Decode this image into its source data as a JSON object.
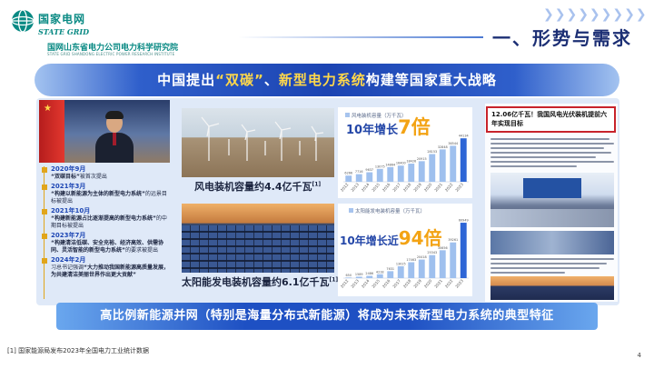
{
  "header": {
    "logo_cn": "国家电网",
    "logo_en": "STATE GRID",
    "org_cn": "国网山东省电力公司电力科学研究院",
    "org_en": "STATE GRID SHANDONG ELECTRIC POWER RESEARCH INSTITUTE",
    "section_title": "一、形势与需求"
  },
  "banner": {
    "part1": "中国提出",
    "hl1": "“双碳”",
    "part2": "、",
    "hl2": "新型电力系统",
    "part3": "构建等国家重大战略"
  },
  "timeline": [
    {
      "date": "2020年9月",
      "pre": "",
      "bold": "“双碳目标”",
      "post": "被首次提出"
    },
    {
      "date": "2021年3月",
      "pre": "",
      "bold": "“构建以新能源为主体的新型电力系统”",
      "post": "的远景目标被提出"
    },
    {
      "date": "2021年10月",
      "pre": "",
      "bold": "“构建新能源占比逐渐提高的新型电力系统”",
      "post": "的中期目标被提出"
    },
    {
      "date": "2023年7月",
      "pre": "",
      "bold": "“构建清洁低碳、安全充裕、经济高效、供需协同、灵活智能的新型电力系统”",
      "post": "的要求被提出"
    },
    {
      "date": "2024年2月",
      "pre": "习总书记强调",
      "bold": "“大力推动我国新能源高质量发展，为共建清洁美丽世界作出更大贡献”",
      "post": ""
    }
  ],
  "captions": {
    "wind": "风电装机容量约4.4亿千瓦",
    "solar": "太阳能发电装机容量约6.1亿千瓦",
    "footnote_ref": "[1]"
  },
  "growth": {
    "wind_pre": "10年增长",
    "wind_mult": "7倍",
    "solar_pre": "10年增长近",
    "solar_mult": "94倍"
  },
  "news": {
    "headline": "12.06亿千瓦！我国风电光伏装机提前六年实现目标"
  },
  "bottom_bar": "高比例新能源并网（特别是海量分布式新能源）将成为未来新型电力系统的典型特征",
  "footnote": "[1] 国家能源局发布2023年全国电力工业统计数据",
  "page_number": "4",
  "colors": {
    "accent": "#1c44b2",
    "highlight": "#ffd84a",
    "bar_gold": "#e1a51a",
    "brand_teal": "#0a8a84"
  },
  "chart_data": [
    {
      "type": "bar",
      "title": "风电装机容量（万千瓦）",
      "categories": [
        "2012",
        "2013",
        "2014",
        "2015",
        "2016",
        "2017",
        "2018",
        "2019",
        "2020",
        "2021",
        "2022",
        "2023"
      ],
      "values": [
        6266,
        7716,
        9637,
        13075,
        14864,
        16400,
        18426,
        20915,
        28153,
        32848,
        36544,
        44134
      ],
      "ylim": [
        0,
        48000
      ],
      "grid": false,
      "data_labels": true
    },
    {
      "type": "bar",
      "title": "太阳能发电装机容量（万千瓦）",
      "categories": [
        "2012",
        "2013",
        "2014",
        "2015",
        "2016",
        "2017",
        "2018",
        "2019",
        "2020",
        "2021",
        "2022",
        "2023"
      ],
      "values": [
        650,
        1589,
        2486,
        4218,
        7631,
        13025,
        17463,
        20418,
        25343,
        30656,
        39261,
        60949
      ],
      "ylim": [
        0,
        66000
      ],
      "grid": false,
      "data_labels": true
    }
  ]
}
